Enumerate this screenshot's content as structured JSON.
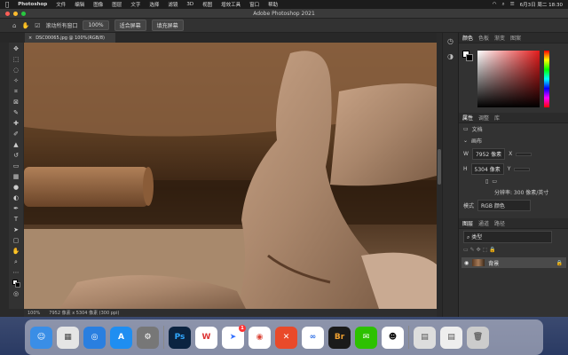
{
  "menubar": {
    "apple": "",
    "app": "Photoshop",
    "items": [
      "文件",
      "编辑",
      "图像",
      "图层",
      "文字",
      "选择",
      "滤镜",
      "3D",
      "视图",
      "增效工具",
      "窗口",
      "帮助"
    ],
    "clock": "6月3日 周二 18:30"
  },
  "window": {
    "title": "Adobe Photoshop 2021"
  },
  "options": {
    "checkbox_label": "滚动所有窗口",
    "zoom_value": "100%",
    "fit_screen": "适合屏幕",
    "fill_screen": "填充屏幕"
  },
  "document": {
    "tab_title": "DSC00065.jpg @ 100%(RGB/8)"
  },
  "status": {
    "zoom": "100%",
    "info": "7952 像素 x 5304 像素 (300 ppi)"
  },
  "panels": {
    "color_tabs": [
      "颜色",
      "色板",
      "渐变",
      "图案"
    ],
    "props_tabs": [
      "属性",
      "调整",
      "库"
    ],
    "doc_label": "文档",
    "canvas_label": "画布",
    "width_label": "W",
    "width_value": "7952 像素",
    "height_label": "H",
    "height_value": "5304 像素",
    "x_label": "X",
    "y_label": "Y",
    "resolution": "分辨率: 300 像素/英寸",
    "mode_label": "模式",
    "mode_value": "RGB 颜色",
    "layers_tabs": [
      "图层",
      "通道",
      "路径"
    ],
    "search_placeholder": "类型",
    "layer_name": "背景"
  },
  "dock": {
    "apps": [
      "Finder",
      "Launchpad",
      "Safari",
      "App Store",
      "System Preferences",
      "Ps",
      "WPS",
      "Lark",
      "Chrome",
      "CrossOver",
      "Baidu",
      "Br",
      "WeChat",
      "QQ",
      "Doc",
      "Doc2",
      "Trash"
    ],
    "badge": "1"
  }
}
